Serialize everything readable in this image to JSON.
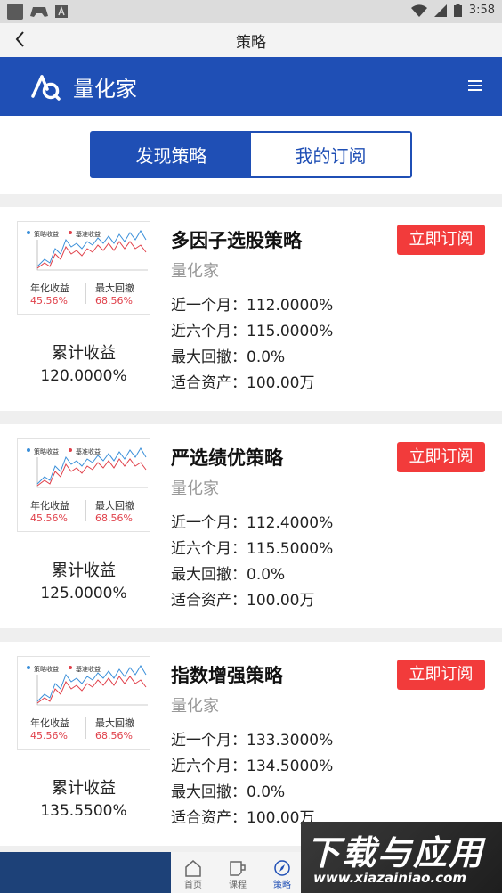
{
  "status": {
    "time": "3:58"
  },
  "header": {
    "title": "策略"
  },
  "brand": {
    "name": "量化家",
    "color": "#1f4fb5"
  },
  "tabs": [
    {
      "label": "发现策略",
      "active": true
    },
    {
      "label": "我的订阅",
      "active": false
    }
  ],
  "thumbnail": {
    "legend_strategy": "策略收益",
    "legend_benchmark": "基准收益",
    "annual_label": "年化收益",
    "annual_value": "45.56%",
    "drawdown_label": "最大回撤",
    "drawdown_value": "68.56%"
  },
  "labels": {
    "cumulative": "累计收益",
    "month1": "近一个月：",
    "month6": "近六个月：",
    "maxdd": "最大回撤：",
    "assets": "适合资产：",
    "subscribe": "立即订阅"
  },
  "strategies": [
    {
      "name": "多因子选股策略",
      "author": "量化家",
      "cumulative": "120.0000%",
      "month1": "112.0000%",
      "month6": "115.0000%",
      "maxdd": "0.0%",
      "assets": "100.00万"
    },
    {
      "name": "严选绩优策略",
      "author": "量化家",
      "cumulative": "125.0000%",
      "month1": "112.4000%",
      "month6": "115.5000%",
      "maxdd": "0.0%",
      "assets": "100.00万"
    },
    {
      "name": "指数增强策略",
      "author": "量化家",
      "cumulative": "135.5500%",
      "month1": "133.3000%",
      "month6": "134.5000%",
      "maxdd": "0.0%",
      "assets": "100.00万"
    }
  ],
  "bottom_nav": [
    {
      "label": "首页",
      "icon": "home-icon",
      "active": false
    },
    {
      "label": "课程",
      "icon": "course-icon",
      "active": false
    },
    {
      "label": "策略",
      "icon": "compass-icon",
      "active": true
    }
  ],
  "watermark": {
    "title": "下载与应用",
    "url": "www.xiazainiao.com"
  }
}
